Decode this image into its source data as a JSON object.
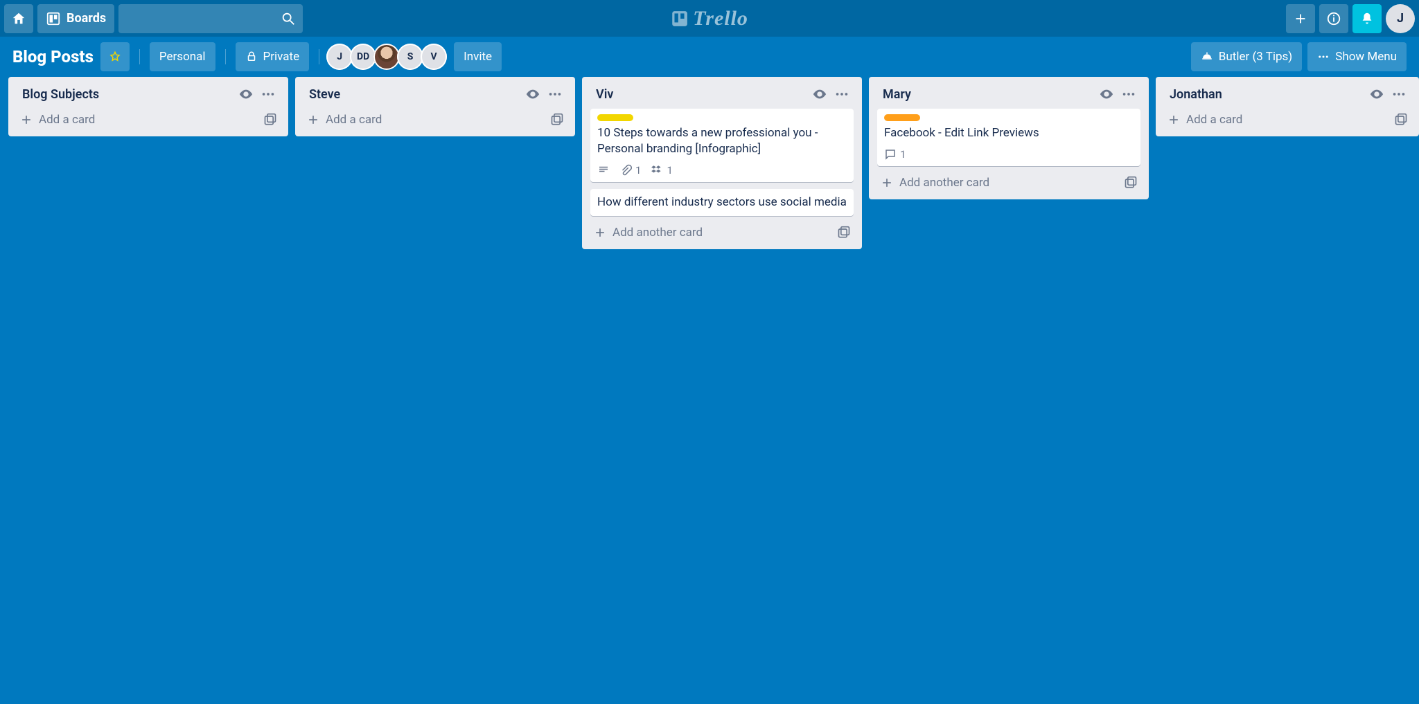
{
  "topbar": {
    "boards_label": "Boards",
    "logo_text": "Trello",
    "me_initial": "J"
  },
  "board": {
    "title": "Blog Posts",
    "visibility_team_label": "Personal",
    "visibility_private_label": "Private",
    "invite_label": "Invite",
    "members": [
      {
        "display": "J",
        "kind": "light"
      },
      {
        "display": "DD",
        "kind": "light"
      },
      {
        "display": "",
        "kind": "photo"
      },
      {
        "display": "S",
        "kind": "light"
      },
      {
        "display": "V",
        "kind": "light"
      }
    ],
    "butler_label": "Butler (3 Tips)",
    "show_menu_label": "Show Menu"
  },
  "lists": [
    {
      "title": "Blog Subjects",
      "add_label": "Add a card",
      "cards": []
    },
    {
      "title": "Steve",
      "add_label": "Add a card",
      "cards": []
    },
    {
      "title": "Viv",
      "add_label": "Add another card",
      "cards": [
        {
          "label_color": "yellow",
          "title": "10 Steps towards a new professional you - Personal branding [Infographic]",
          "has_description": true,
          "attachments": "1",
          "dropbox": "1"
        },
        {
          "title": "How different industry sectors use social media"
        }
      ]
    },
    {
      "title": "Mary",
      "add_label": "Add another card",
      "cards": [
        {
          "label_color": "orange",
          "title": "Facebook - Edit Link Previews",
          "comments": "1"
        }
      ]
    },
    {
      "title": "Jonathan",
      "add_label": "Add a card",
      "cards": []
    }
  ]
}
